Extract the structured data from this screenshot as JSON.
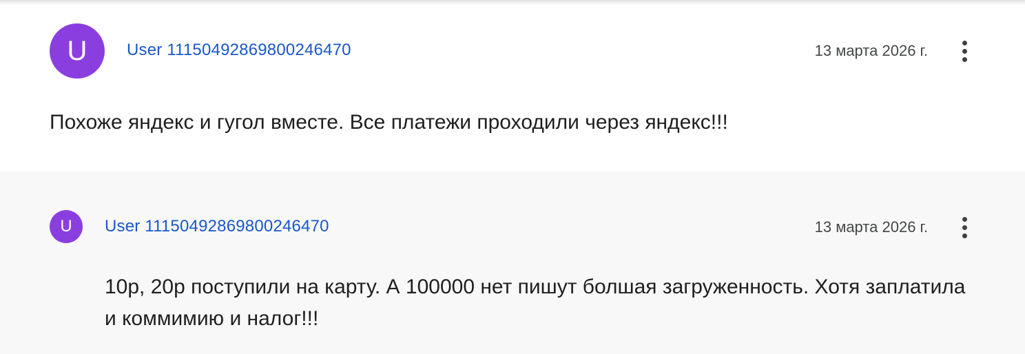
{
  "review": {
    "avatar_letter": "U",
    "author": "User 11150492869800246470",
    "date": "13 марта 2026 г.",
    "text": "Похоже яндекс и гугол вместе. Все платежи проходили через яндекс!!!",
    "more_icon": "more-vert-icon"
  },
  "reply": {
    "avatar_letter": "U",
    "author": "User 11150492869800246470",
    "date": "13 марта 2026 г.",
    "text": "10р, 20р поступили на карту. А 100000 нет пишут болшая загруженность. Хотя заплатила и коммимию и налог!!!",
    "more_icon": "more-vert-icon"
  },
  "colors": {
    "avatar": "#8b3ee0",
    "author_link": "#1a57c8",
    "reply_background": "#f8f8f8"
  }
}
